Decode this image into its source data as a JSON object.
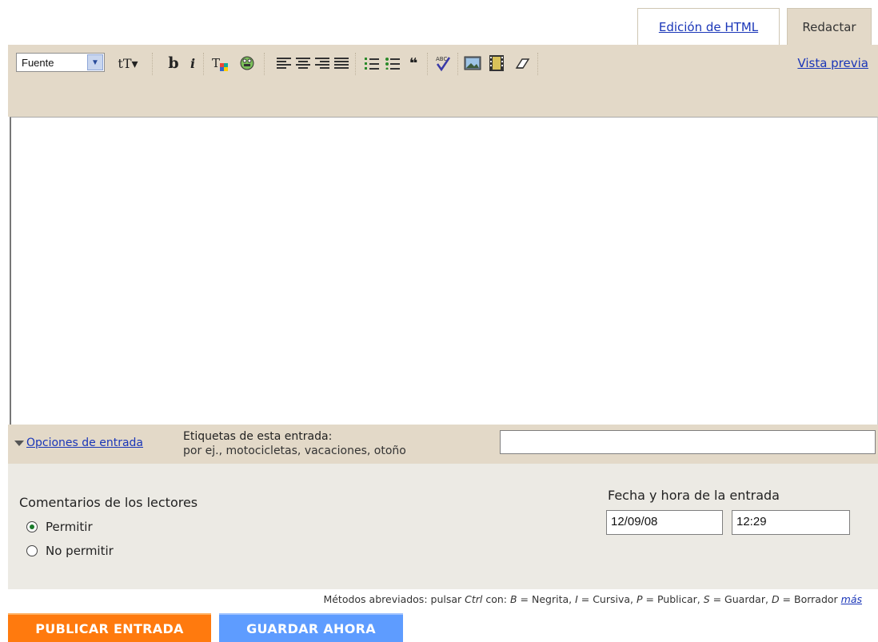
{
  "tabs": {
    "html_edit": "Edición de HTML",
    "compose": "Redactar"
  },
  "toolbar": {
    "font_select": "Fuente",
    "preview_link": "Vista previa",
    "icons": {
      "text_size": "tT▾",
      "bold": "b",
      "italic": "i",
      "text_color": "T",
      "link": "⊕",
      "align_left": "☰",
      "align_center": "☰",
      "align_right": "☰",
      "justify": "☰",
      "numbered_list": "⋮☰",
      "bulleted_list": "⋮☰",
      "quote": "❝",
      "spellcheck": "✔",
      "image": "▣",
      "video": "▦",
      "clear_format": "⌫"
    }
  },
  "labels": {
    "options_link": "Opciones de entrada",
    "title": "Etiquetas de esta entrada:",
    "hint": "por ej., motocicletas, vacaciones, otoño",
    "value": ""
  },
  "comments": {
    "title": "Comentarios de los lectores",
    "allow": "Permitir",
    "deny": "No permitir"
  },
  "date": {
    "title": "Fecha y hora de la entrada",
    "date_value": "12/09/08",
    "time_value": "12:29"
  },
  "shortcuts": {
    "prefix": "Métodos abreviados: pulsar ",
    "ctrl": "Ctrl",
    "con": " con: ",
    "b_key": "B",
    "b_text": " = Negrita, ",
    "i_key": "I",
    "i_text": " = Cursiva, ",
    "p_key": "P",
    "p_text": " = Publicar, ",
    "s_key": "S",
    "s_text": " = Guardar, ",
    "d_key": "D",
    "d_text": " = Borrador ",
    "more": "más"
  },
  "buttons": {
    "publish": "PUBLICAR ENTRADA",
    "save": "GUARDAR AHORA"
  },
  "colors": {
    "toolbar_bg": "#e3d9c8",
    "link": "#1a36b8",
    "publish": "#ff7a0e",
    "save": "#5e9cff"
  }
}
